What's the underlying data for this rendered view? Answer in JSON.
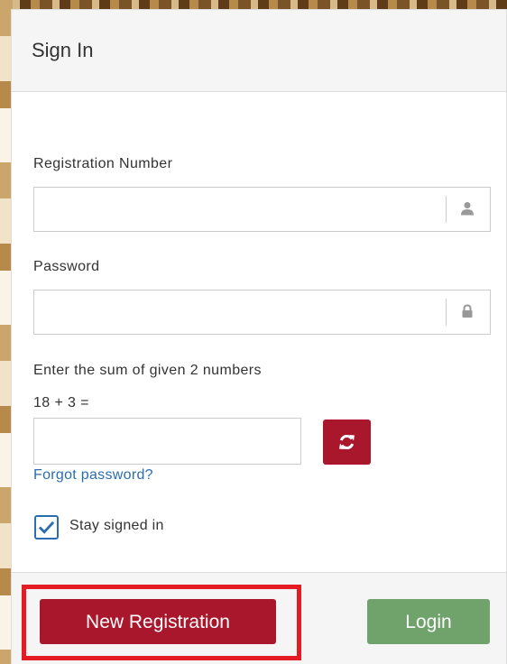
{
  "panel": {
    "title": "Sign In"
  },
  "form": {
    "registration_label": "Registration Number",
    "registration_value": "",
    "registration_icon": "user-icon",
    "password_label": "Password",
    "password_value": "",
    "password_icon": "lock-icon",
    "captcha_prompt": "Enter the sum of given 2 numbers",
    "captcha_question": "18 + 3 =",
    "captcha_value": "",
    "refresh_icon": "refresh-icon",
    "forgot_password": "Forgot password?",
    "stay_signed_in_label": "Stay signed in",
    "stay_signed_in_checked": true
  },
  "footer": {
    "new_registration_label": "New Registration",
    "login_label": "Login"
  },
  "colors": {
    "accent_red": "#a8172b",
    "login_green": "#6fa36b",
    "link_blue": "#2a6db0",
    "highlight_red": "#e51c24"
  }
}
